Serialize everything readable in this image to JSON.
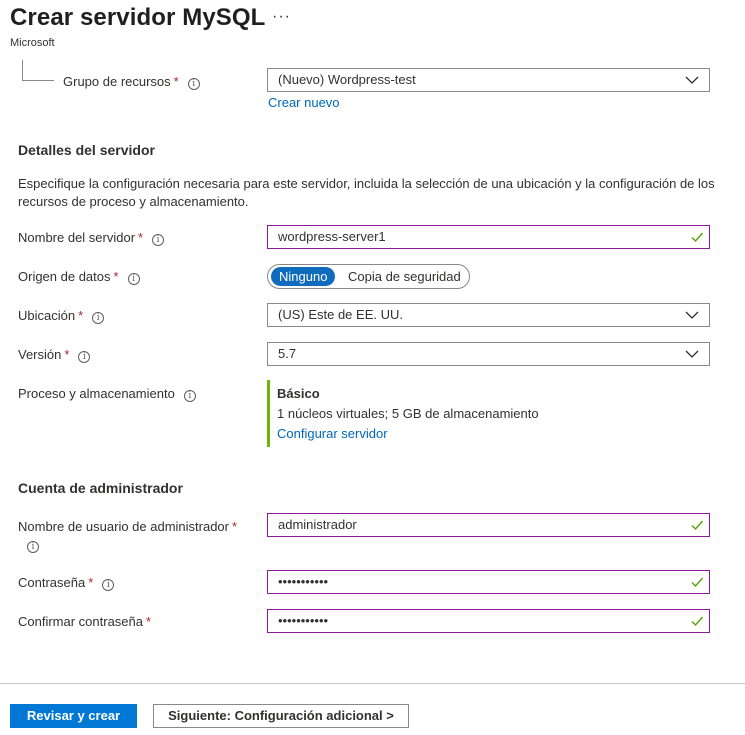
{
  "header": {
    "title": "Crear servidor MySQL",
    "more": "···",
    "publisher": "Microsoft"
  },
  "resource_group": {
    "label": "Grupo de recursos",
    "required": "*",
    "value": "(Nuevo) Wordpress-test",
    "create_new": "Crear nuevo"
  },
  "server_details": {
    "heading": "Detalles del servidor",
    "description": "Especifique la configuración necesaria para este servidor, incluida la selección de una ubicación y la configuración de los recursos de proceso y almacenamiento.",
    "server_name": {
      "label": "Nombre del servidor",
      "required": "*",
      "value": "wordpress-server1"
    },
    "data_source": {
      "label": "Origen de datos",
      "required": "*",
      "options": [
        "Ninguno",
        "Copia de seguridad"
      ],
      "selected": "Ninguno"
    },
    "location": {
      "label": "Ubicación",
      "required": "*",
      "value": "(US) Este de EE. UU."
    },
    "version": {
      "label": "Versión",
      "required": "*",
      "value": "5.7"
    },
    "compute": {
      "label": "Proceso y almacenamiento",
      "tier": "Básico",
      "summary": "1 núcleos virtuales; 5 GB de almacenamiento",
      "configure_link": "Configurar servidor",
      "accent_color": "#6bb700"
    }
  },
  "admin_account": {
    "heading": "Cuenta de administrador",
    "username": {
      "label": "Nombre de usuario de administrador",
      "required": "*",
      "value": "administrador"
    },
    "password": {
      "label": "Contraseña",
      "required": "*",
      "value": "•••••••••••"
    },
    "confirm_password": {
      "label": "Confirmar contraseña",
      "required": "*",
      "value": "•••••••••••"
    }
  },
  "footer": {
    "review_create": "Revisar y crear",
    "next": "Siguiente: Configuración adicional >"
  },
  "colors": {
    "primary": "#0078d4",
    "link": "#0067b8",
    "required": "#a4262c",
    "valid_check": "#57a300",
    "valid_border": "#8a1c9a"
  },
  "icons": {
    "info": "info-icon",
    "dropdown": "chevron-down-icon",
    "valid": "checkmark-icon"
  }
}
